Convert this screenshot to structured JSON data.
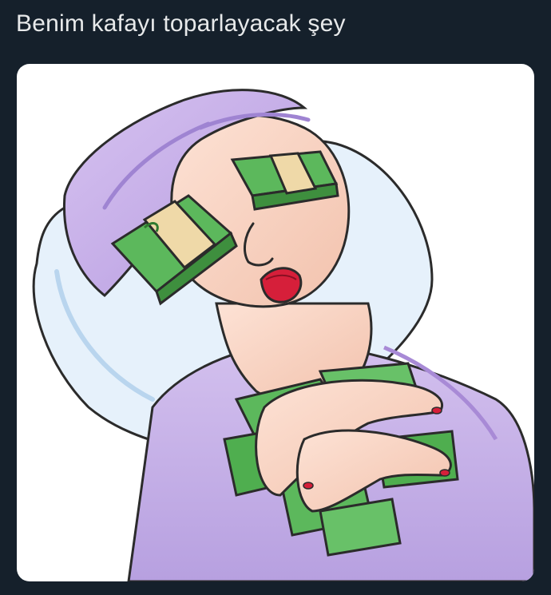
{
  "post": {
    "text": "Benim kafayı toparlayacak şey"
  },
  "media": {
    "type": "illustration",
    "colors": {
      "background": "#15202b",
      "text": "#e7e9ea",
      "card": "#ffffff",
      "towel": "#c7aee8",
      "robe": "#c8b3e6",
      "pillow": "#e6f1fb",
      "skin": "#f6d0c0",
      "money_green": "#5cb85c",
      "band": "#efd9a8",
      "lips": "#d61f3a"
    }
  }
}
